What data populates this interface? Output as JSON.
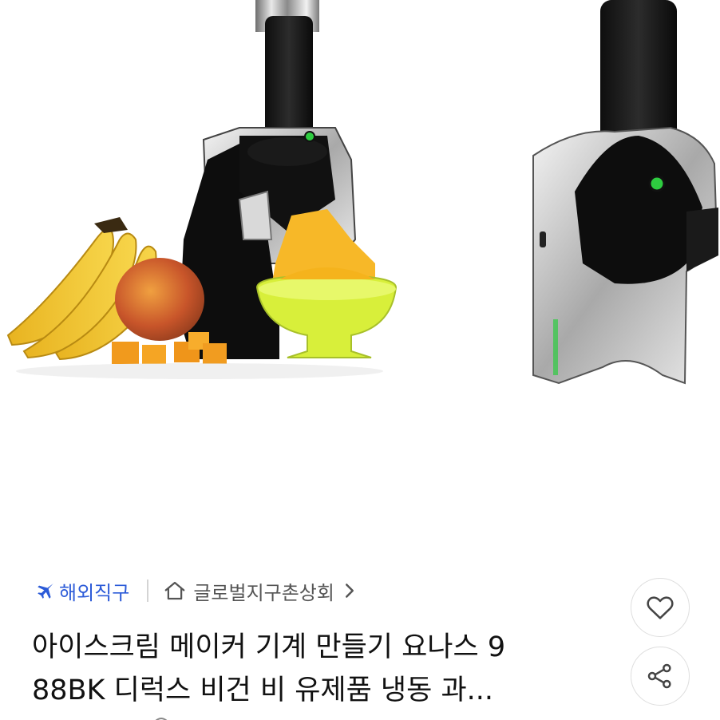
{
  "product": {
    "badge_label": "해외직구",
    "store_label": "글로벌지구촌상회",
    "title_line1": "아이스크림 메이커 기계 만들기 요나스 9",
    "title_line2": "88BK 디럭스 비건 비 유제품 냉동 과...",
    "icons": {
      "badge": "airplane-icon",
      "store": "home-icon",
      "store_link": "chevron-right-icon",
      "like": "heart-icon",
      "share": "share-icon"
    },
    "colors": {
      "badge": "#2c5bd8",
      "text": "#111111",
      "subtle": "#555555",
      "accent_green": "#2ecc40"
    }
  }
}
